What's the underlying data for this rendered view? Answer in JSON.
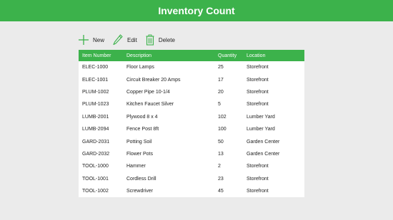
{
  "header": {
    "title": "Inventory Count"
  },
  "toolbar": {
    "new_label": "New",
    "edit_label": "Edit",
    "delete_label": "Delete"
  },
  "table": {
    "columns": [
      "Item Number",
      "Description",
      "Quantity",
      "Location"
    ],
    "rows": [
      [
        "ELEC-1000",
        "Floor Lamps",
        "25",
        "Storefront"
      ],
      [
        "ELEC-1001",
        "Circuit Breaker 20 Amps",
        "17",
        "Storefront"
      ],
      [
        "PLUM-1002",
        "Copper Pipe 10-1/4",
        "20",
        "Storefront"
      ],
      [
        "PLUM-1023",
        "Kitchen Faucet Silver",
        "5",
        "Storefront"
      ],
      [
        "LUMB-2001",
        "Plywood 8 x 4",
        "102",
        "Lumber Yard"
      ],
      [
        "LUMB-2094",
        "Fence Post 8ft",
        "100",
        "Lumber Yard"
      ],
      [
        "GARD-2031",
        "Potting Soil",
        "50",
        "Garden Center"
      ],
      [
        "GARD-2032",
        "Flower Pots",
        "13",
        "Garden Center"
      ],
      [
        "TOOL-1000",
        "Hammer",
        "2",
        "Storefront"
      ],
      [
        "TOOL-1001",
        "Cordless Drill",
        "23",
        "Storefront"
      ],
      [
        "TOOL-1002",
        "Screwdriver",
        "45",
        "Storefront"
      ]
    ]
  },
  "colors": {
    "accent": "#3cb24b",
    "background": "#ebebeb"
  }
}
